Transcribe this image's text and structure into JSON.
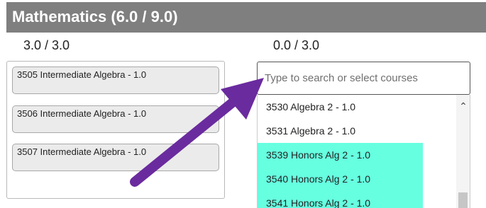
{
  "header": {
    "title": "Mathematics (6.0 / 9.0)"
  },
  "credits": {
    "selected": "3.0 / 3.0",
    "available": "0.0 / 3.0"
  },
  "selected_courses": [
    {
      "label": "3505 Intermediate Algebra - 1.0"
    },
    {
      "label": "3506 Intermediate Algebra - 1.0"
    },
    {
      "label": "3507 Intermediate Algebra - 1.0"
    }
  ],
  "search": {
    "placeholder": "Type to search or select courses",
    "value": ""
  },
  "course_options": [
    {
      "label": "3530 Algebra 2 - 1.0",
      "highlighted": false
    },
    {
      "label": "3531 Algebra 2 - 1.0",
      "highlighted": false
    },
    {
      "label": "3539 Honors Alg 2 - 1.0",
      "highlighted": true
    },
    {
      "label": "3540 Honors Alg 2 - 1.0",
      "highlighted": true
    },
    {
      "label": "3541 Honors Alg 2 - 1.0",
      "highlighted": true
    }
  ],
  "colors": {
    "header_bg": "#7f7f7f",
    "highlight": "#66ffe0",
    "annotation_arrow": "#6a2b9e"
  },
  "icons": {
    "scroll_up": "chevron-up-icon",
    "annotation": "arrow-annotation-icon"
  },
  "glyphs": {
    "scroll_up": "⌃"
  }
}
